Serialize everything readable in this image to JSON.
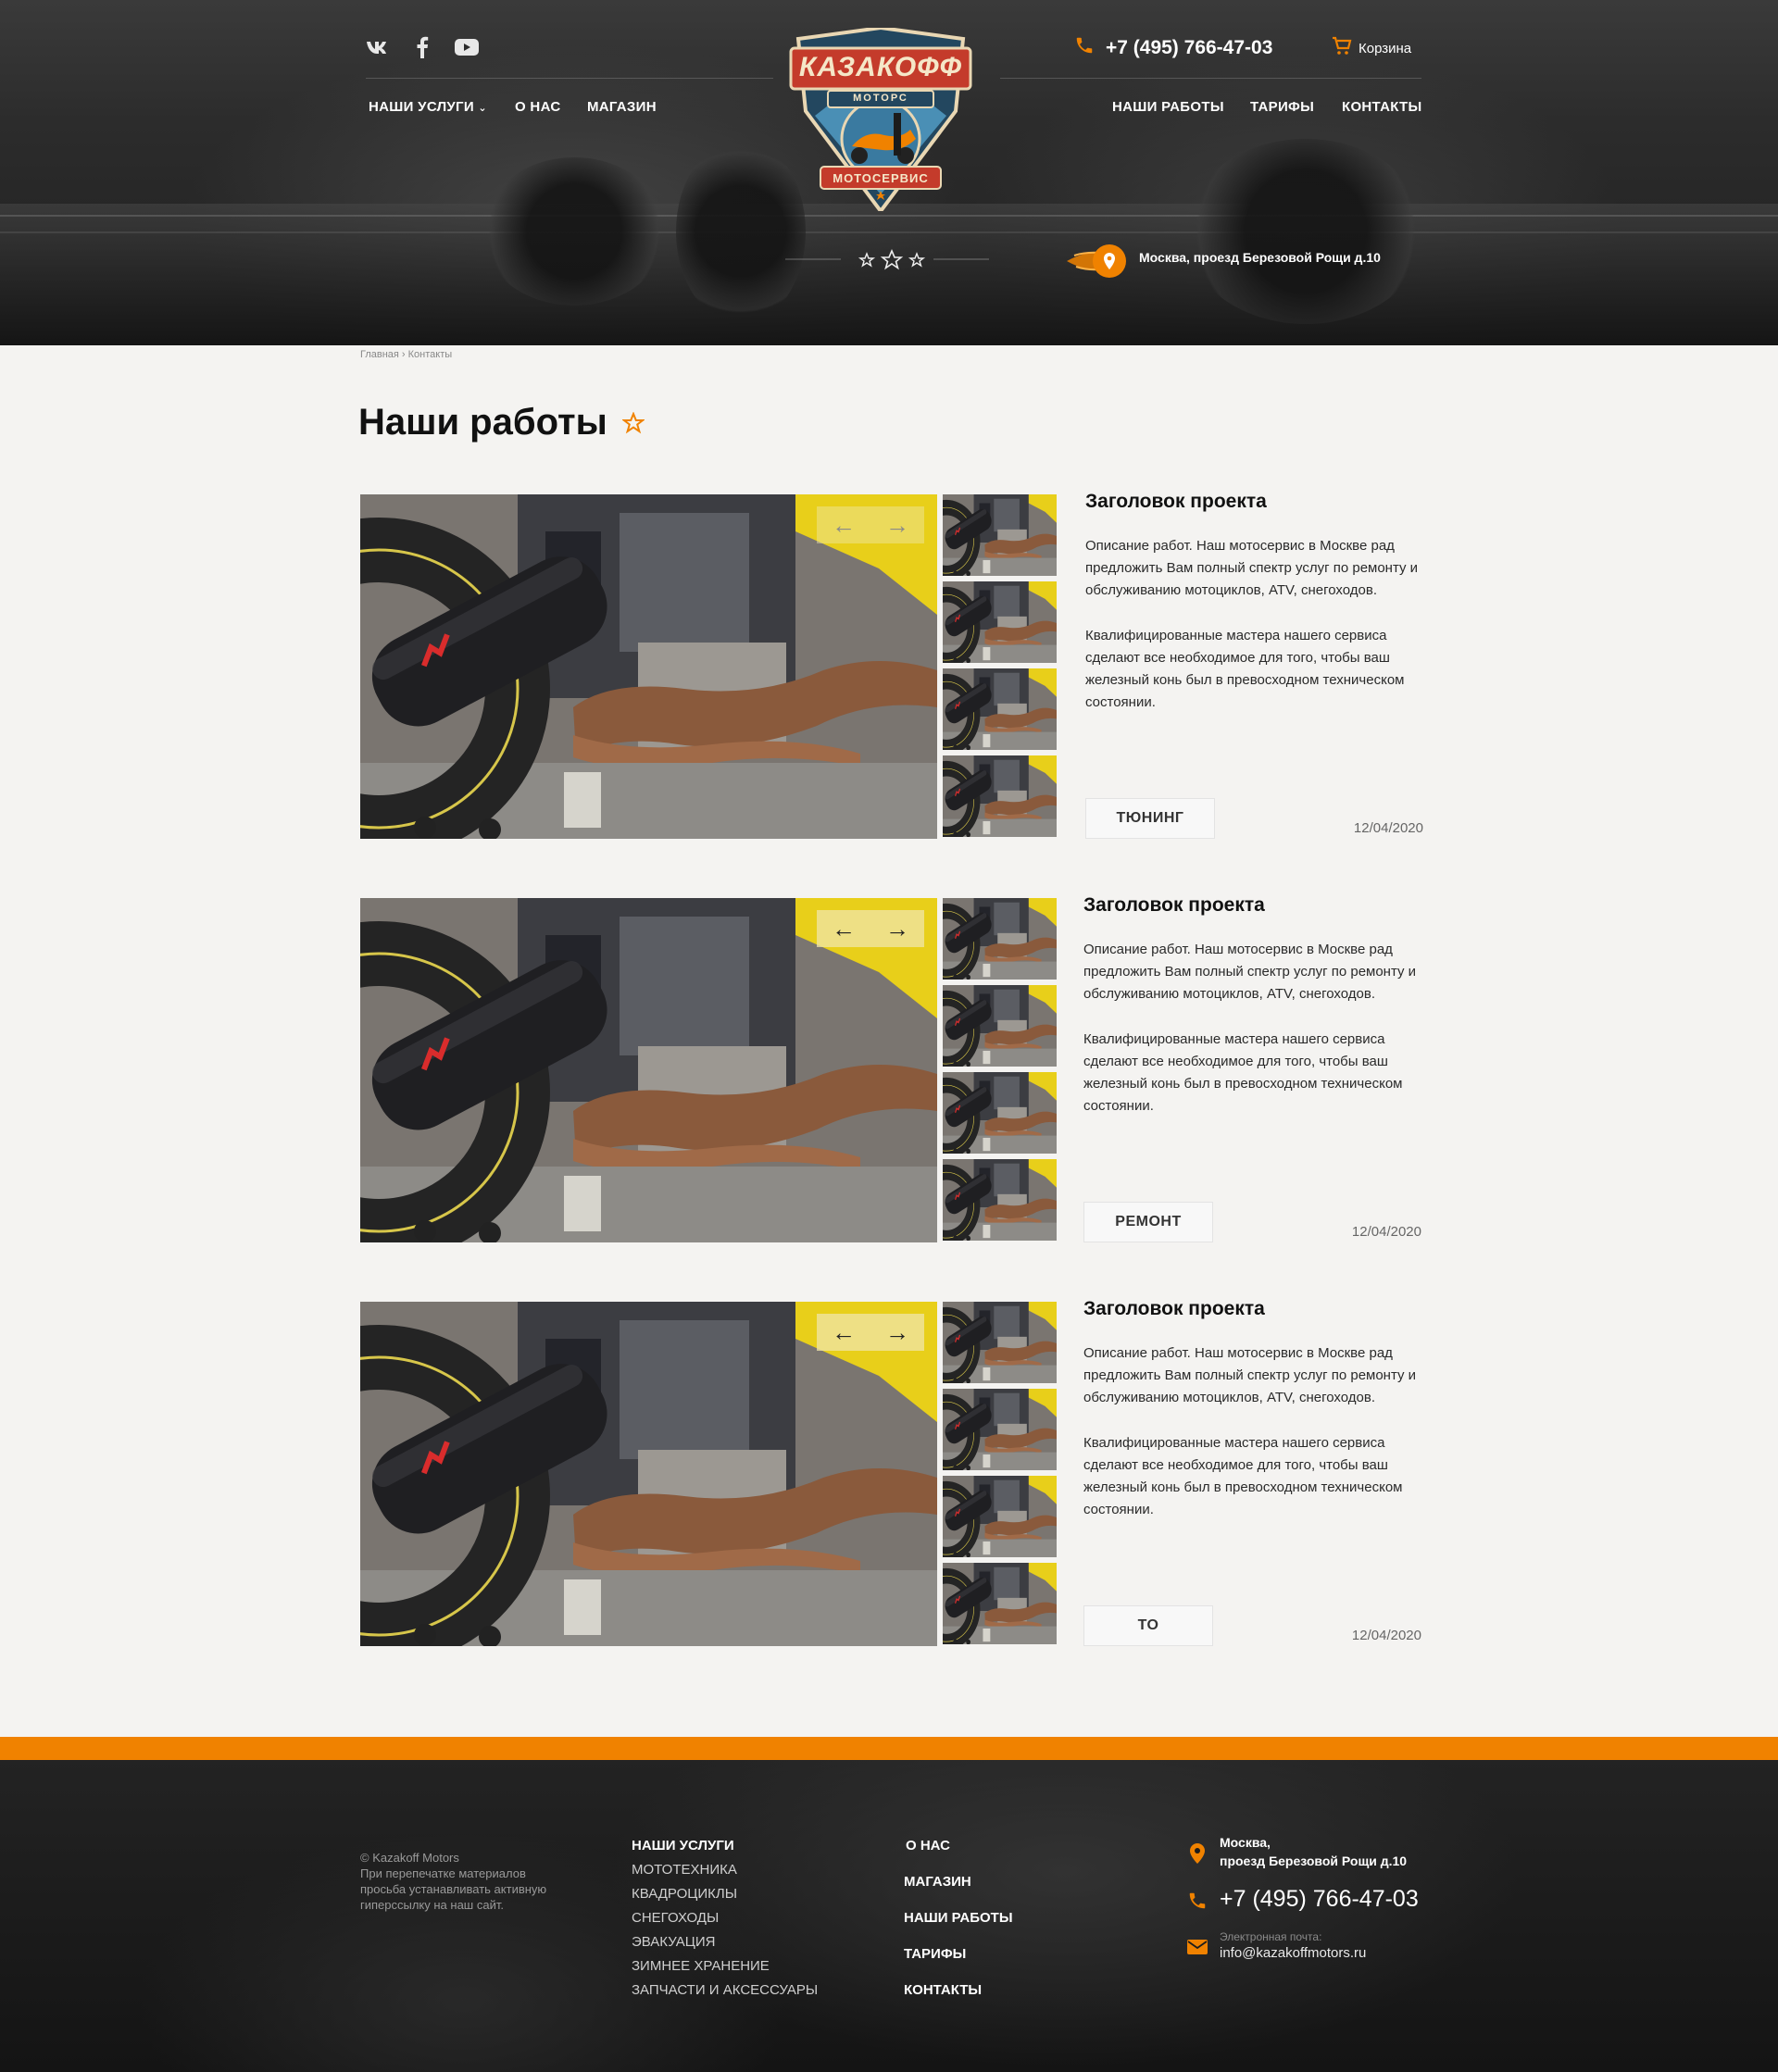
{
  "header": {
    "social": [
      "vk-icon",
      "facebook-icon",
      "youtube-icon"
    ],
    "nav_left": [
      "НАШИ УСЛУГИ",
      "О НАС",
      "МАГАЗИН"
    ],
    "nav_right": [
      "НАШИ РАБОТЫ",
      "ТАРИФЫ",
      "КОНТАКТЫ"
    ],
    "phone": "+7 (495) 766-47-03",
    "cart_label": "Корзина",
    "address": "Москва, проезд Березовой Рощи д.10",
    "logo": {
      "brand": "КАЗАКОФФ",
      "sub": "МОТОРС",
      "ribbon": "МОТОСЕРВИС"
    }
  },
  "breadcrumb": "Главная › Контакты",
  "page_title": "Наши работы",
  "projects": [
    {
      "title": "Заголовок проекта",
      "desc1": "Описание работ. Наш мотосервис в Москве рад предложить Вам полный спектр услуг по ремонту и обслуживанию мотоциклов, ATV, снегоходов.",
      "desc2": "Квалифицированные мастера нашего сервиса сделают все необходимое для того, чтобы ваш железный конь был в превосходном техническом состоянии.",
      "tag": "ТЮНИНГ",
      "date": "12/04/2020"
    },
    {
      "title": "Заголовок проекта",
      "desc1": "Описание работ. Наш мотосервис в Москве рад предложить Вам полный спектр услуг по ремонту и обслуживанию мотоциклов, ATV, снегоходов.",
      "desc2": "Квалифицированные мастера нашего сервиса сделают все необходимое для того, чтобы ваш железный конь был в превосходном техническом состоянии.",
      "tag": "РЕМОНТ",
      "date": "12/04/2020"
    },
    {
      "title": "Заголовок проекта",
      "desc1": "Описание работ. Наш мотосервис в Москве рад предложить Вам полный спектр услуг по ремонту и обслуживанию мотоциклов, ATV, снегоходов.",
      "desc2": "Квалифицированные мастера нашего сервиса сделают все необходимое для того, чтобы ваш железный конь был в превосходном техническом состоянии.",
      "tag": "ТО",
      "date": "12/04/2020"
    }
  ],
  "footer": {
    "copyright": "© Kazakoff Motors\nПри перепечатке материалов просьба устанавливать активную гиперссылку на наш сайт.",
    "services_head": "НАШИ УСЛУГИ",
    "services": [
      "МОТОТЕХНИКА",
      "КВАДРОЦИКЛЫ",
      "СНЕГОХОДЫ",
      "ЭВАКУАЦИЯ",
      "ЗИМНЕЕ ХРАНЕНИЕ",
      "ЗАПЧАСТИ И АКСЕССУАРЫ"
    ],
    "links": [
      "О НАС",
      "МАГАЗИН",
      "НАШИ РАБОТЫ",
      "ТАРИФЫ",
      "КОНТАКТЫ"
    ],
    "address_line1": "Москва,",
    "address_line2": "проезд Березовой Рощи д.10",
    "phone": "+7 (495) 766-47-03",
    "email_label": "Электронная почта:",
    "email": "info@kazakoffmotors.ru"
  },
  "colors": {
    "accent": "#f08200",
    "dark": "#1f1f1f",
    "light_bg": "#f4f3f1"
  }
}
